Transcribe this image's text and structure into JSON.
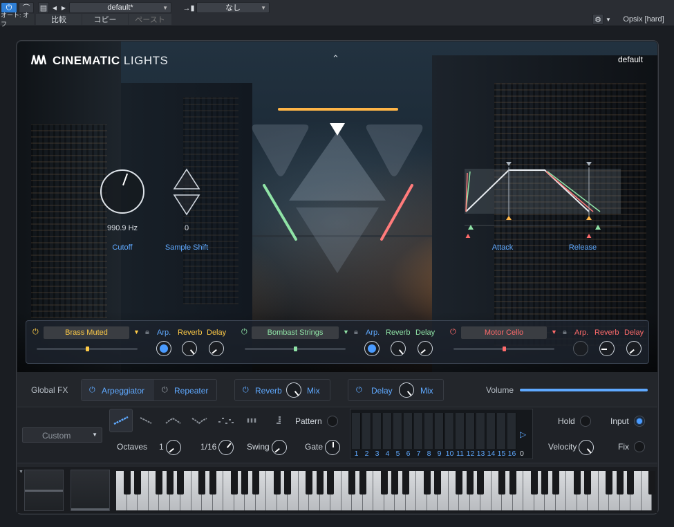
{
  "host": {
    "auto_label": "オート: オフ",
    "preset_name": "default*",
    "compare_label": "比較",
    "copy_label": "コピー",
    "paste_label": "ペースト",
    "sidechain_value": "なし",
    "instrument_name": "Opsix [hard]"
  },
  "plugin": {
    "logo_text": "CINEMATIC",
    "logo_text2": "LIGHTS",
    "preset": "default",
    "colors": {
      "accent": "#5fa9ff",
      "green": "#8fe3a6",
      "red": "#ff6b6b",
      "orange": "#ffb547"
    }
  },
  "macros": {
    "cutoff": {
      "label": "Cutoff",
      "value": "990.9 Hz"
    },
    "sample_shift": {
      "label": "Sample Shift",
      "value": "0"
    },
    "attack_label": "Attack",
    "release_label": "Release"
  },
  "layers": [
    {
      "name": "Brass Muted",
      "arp": "Arp.",
      "reverb": "Reverb",
      "delay": "Delay",
      "color": "#ffcb47"
    },
    {
      "name": "Bombast Strings",
      "arp": "Arp.",
      "reverb": "Reverb",
      "delay": "Delay",
      "color": "#8fe3a6"
    },
    {
      "name": "Motor Cello",
      "arp": "Arp.",
      "reverb": "Reverb",
      "delay": "Delay",
      "color": "#ff6b6b"
    }
  ],
  "global_fx": {
    "label": "Global FX",
    "arpeggiator": "Arpeggiator",
    "repeater": "Repeater",
    "reverb": "Reverb",
    "reverb_mix": "Mix",
    "delay": "Delay",
    "delay_mix": "Mix",
    "volume": "Volume"
  },
  "arp": {
    "mode": "Custom",
    "pattern_label": "Pattern",
    "octaves_label": "Octaves",
    "octaves_value": "1",
    "rate_value": "1/16",
    "swing_label": "Swing",
    "gate_label": "Gate",
    "steps": [
      "1",
      "2",
      "3",
      "4",
      "5",
      "6",
      "7",
      "8",
      "9",
      "10",
      "11",
      "12",
      "13",
      "14",
      "15",
      "16"
    ],
    "step_offset": "0",
    "hold_label": "Hold",
    "input_label": "Input",
    "velocity_label": "Velocity",
    "fix_label": "Fix"
  }
}
